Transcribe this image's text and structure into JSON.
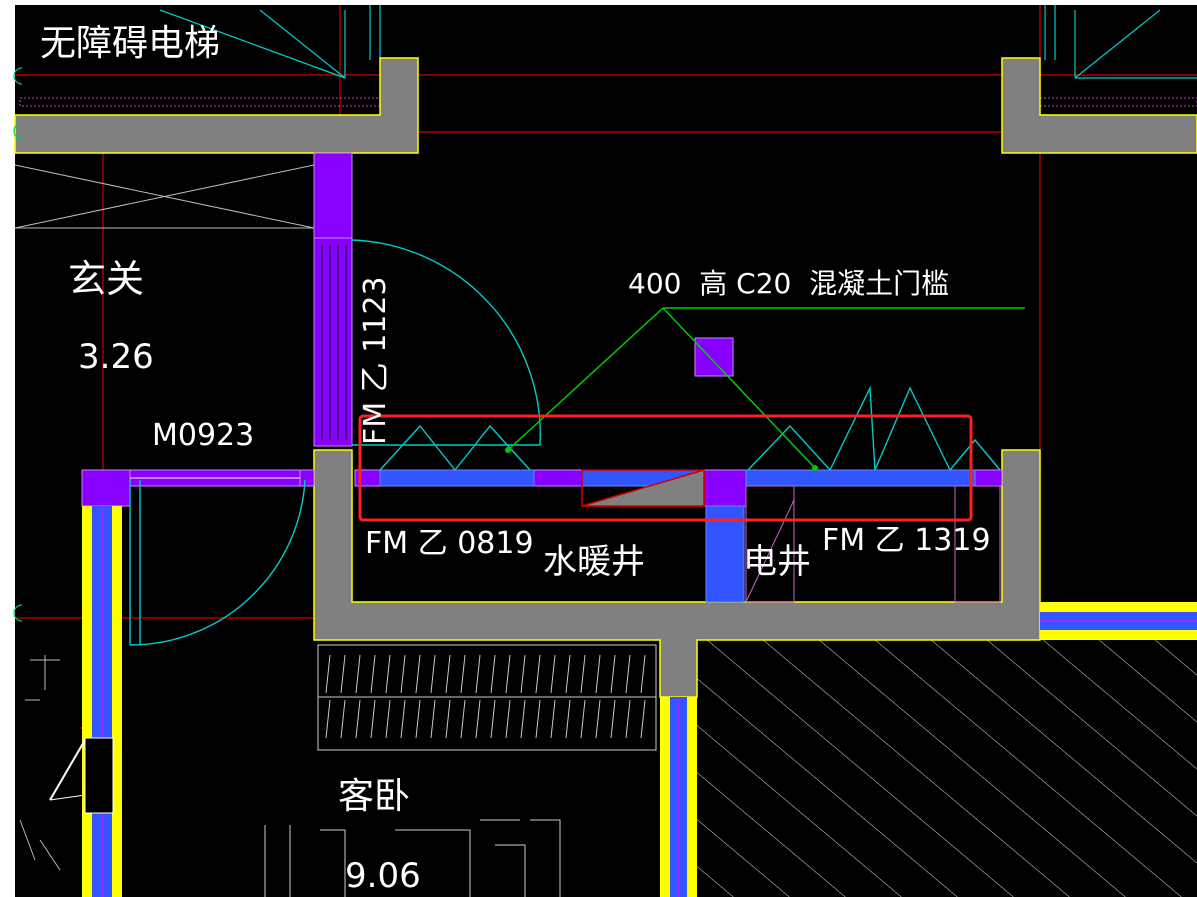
{
  "colors": {
    "background": "#000000",
    "wall_fill": "#808080",
    "wall_outline": "#ffff00",
    "grid_line": "#cc0000",
    "door_swing": "#00cccc",
    "column": "#8800ff",
    "window_blue": "#3355ff",
    "leader": "#00cc00",
    "highlight_box": "#ff2020",
    "hatch": "#dddddd",
    "text": "#ffffff"
  },
  "labels": {
    "elevator": "无障碍电梯",
    "foyer_name": "玄关",
    "foyer_area": "3.26",
    "door_m0923": "M0923",
    "door_fm_vertical": "FM 乙 1123",
    "threshold_note": "400  高 C20  混凝土门槛",
    "fm_0819": "FM 乙 0819",
    "plumbing_shaft": "水暖井",
    "electric_shaft": "电井",
    "fm_1319": "FM 乙 1319",
    "guest_bedroom": "客卧",
    "bedroom_area": "9.06"
  }
}
